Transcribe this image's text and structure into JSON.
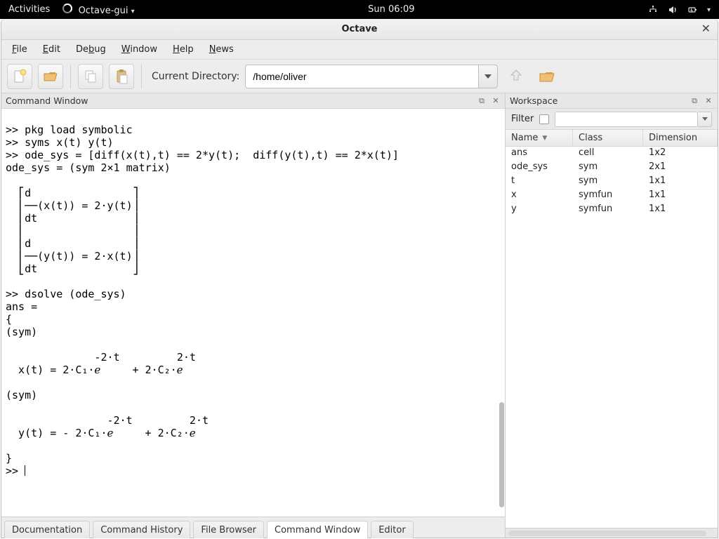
{
  "gnome": {
    "activities": "Activities",
    "app_name": "Octave-gui",
    "clock": "Sun 06:09"
  },
  "window": {
    "title": "Octave"
  },
  "menubar": [
    "File",
    "Edit",
    "Debug",
    "Window",
    "Help",
    "News"
  ],
  "toolbar": {
    "dir_label": "Current Directory:",
    "dir_value": "/home/oliver"
  },
  "left_panel": {
    "title": "Command Window"
  },
  "command_output": ">> pkg load symbolic\n>> syms x(t) y(t)\n>> ode_sys = [diff(x(t),t) == 2*y(t);  diff(y(t),t) == 2*x(t)]\node_sys = (sym 2×1 matrix)\n\n  ⎡d                ⎤\n  ⎢──(x(t)) = 2⋅y(t)⎥\n  ⎢dt               ⎥\n  ⎢                 ⎥\n  ⎢d                ⎥\n  ⎢──(y(t)) = 2⋅x(t)⎥\n  ⎣dt               ⎦\n\n>> dsolve (ode_sys)\nans =\n{\n(sym)\n\n              -2⋅t         2⋅t\n  x(t) = 2⋅C₁⋅ℯ     + 2⋅C₂⋅ℯ\n\n(sym)\n\n                -2⋅t         2⋅t\n  y(t) = - 2⋅C₁⋅ℯ     + 2⋅C₂⋅ℯ\n\n}\n>> ",
  "tabs": [
    {
      "id": "documentation",
      "label": "Documentation",
      "active": false
    },
    {
      "id": "command-history",
      "label": "Command History",
      "active": false
    },
    {
      "id": "file-browser",
      "label": "File Browser",
      "active": false
    },
    {
      "id": "command-window",
      "label": "Command Window",
      "active": true
    },
    {
      "id": "editor",
      "label": "Editor",
      "active": false
    }
  ],
  "workspace": {
    "title": "Workspace",
    "filter_label": "Filter",
    "filter_value": "",
    "columns": [
      "Name",
      "Class",
      "Dimension"
    ],
    "rows": [
      {
        "name": "ans",
        "class": "cell",
        "dim": "1x2"
      },
      {
        "name": "ode_sys",
        "class": "sym",
        "dim": "2x1"
      },
      {
        "name": "t",
        "class": "sym",
        "dim": "1x1"
      },
      {
        "name": "x",
        "class": "symfun",
        "dim": "1x1"
      },
      {
        "name": "y",
        "class": "symfun",
        "dim": "1x1"
      }
    ]
  }
}
